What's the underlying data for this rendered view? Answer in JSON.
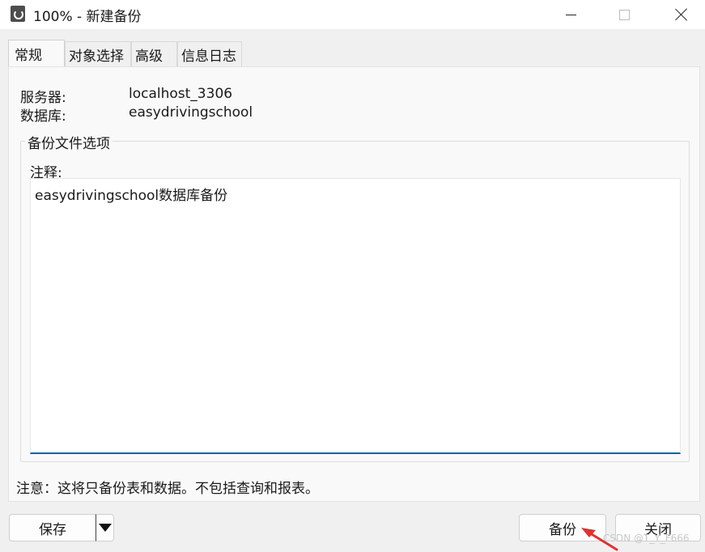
{
  "window": {
    "title": "100% - 新建备份"
  },
  "tabs": [
    {
      "label": "常规",
      "active": true
    },
    {
      "label": "对象选择",
      "active": false
    },
    {
      "label": "高级",
      "active": false
    },
    {
      "label": "信息日志",
      "active": false
    }
  ],
  "general": {
    "server_label": "服务器:",
    "server_value": "localhost_3306",
    "database_label": "数据库:",
    "database_value": "easydrivingschool",
    "group_title": "备份文件选项",
    "comment_label": "注释:",
    "comment_value": "easydrivingschool数据库备份",
    "note": "注意：这将只备份表和数据。不包括查询和报表。"
  },
  "buttons": {
    "save": "保存",
    "backup": "备份",
    "close": "关闭"
  },
  "watermark": "CSDN @T_Y_F666",
  "colors": {
    "accent": "#005fb8",
    "annotation_arrow": "#e03030"
  },
  "icons": {
    "app": "backup-app-icon",
    "minimize": "minimize-icon",
    "maximize": "maximize-icon",
    "close": "close-icon",
    "dropdown": "triangle-down-icon"
  }
}
